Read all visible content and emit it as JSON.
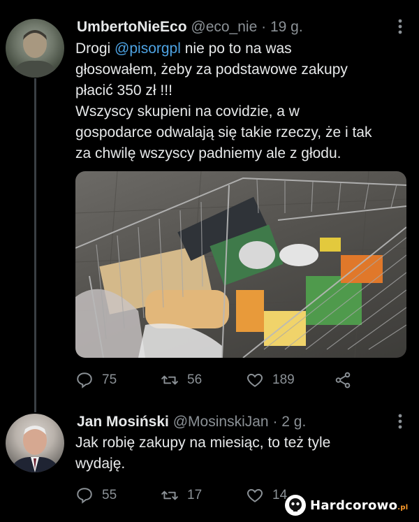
{
  "tweet1": {
    "display_name": "UmbertoNieEco",
    "handle": "@eco_nie",
    "separator": "·",
    "time": "19 g.",
    "text_lines": [
      {
        "before": "Drogi ",
        "mention": "@pisorgpl",
        "after": " nie po to na was"
      },
      {
        "text": "głosowałem, żeby za podstawowe zakupy"
      },
      {
        "text": "płacić 350 zł !!!"
      },
      {
        "text": "Wszyscy skupieni na covidzie, a w"
      },
      {
        "text": "gospodarce odwalają się takie rzeczy, że i tak"
      },
      {
        "text": "za chwilę wszyscy padniemy ale z głodu."
      }
    ],
    "replies": "75",
    "retweets": "56",
    "likes": "189"
  },
  "tweet2": {
    "display_name": "Jan Mosiński",
    "handle": "@MosinskiJan",
    "separator": "·",
    "time": "2 g.",
    "text_lines": [
      {
        "text": "Jak robię zakupy na miesiąc, to też tyle"
      },
      {
        "text": "wydaję."
      }
    ],
    "replies": "55",
    "retweets": "17",
    "likes": "14"
  },
  "watermark": {
    "name": "Hardcorowo",
    "suffix": ".pl"
  },
  "icons": {
    "more": "more-vertical-icon",
    "reply": "reply-icon",
    "retweet": "retweet-icon",
    "like": "heart-icon",
    "share": "share-icon"
  },
  "colors": {
    "background": "#000000",
    "mention": "#4ea3e3",
    "muted": "#8b9196"
  }
}
